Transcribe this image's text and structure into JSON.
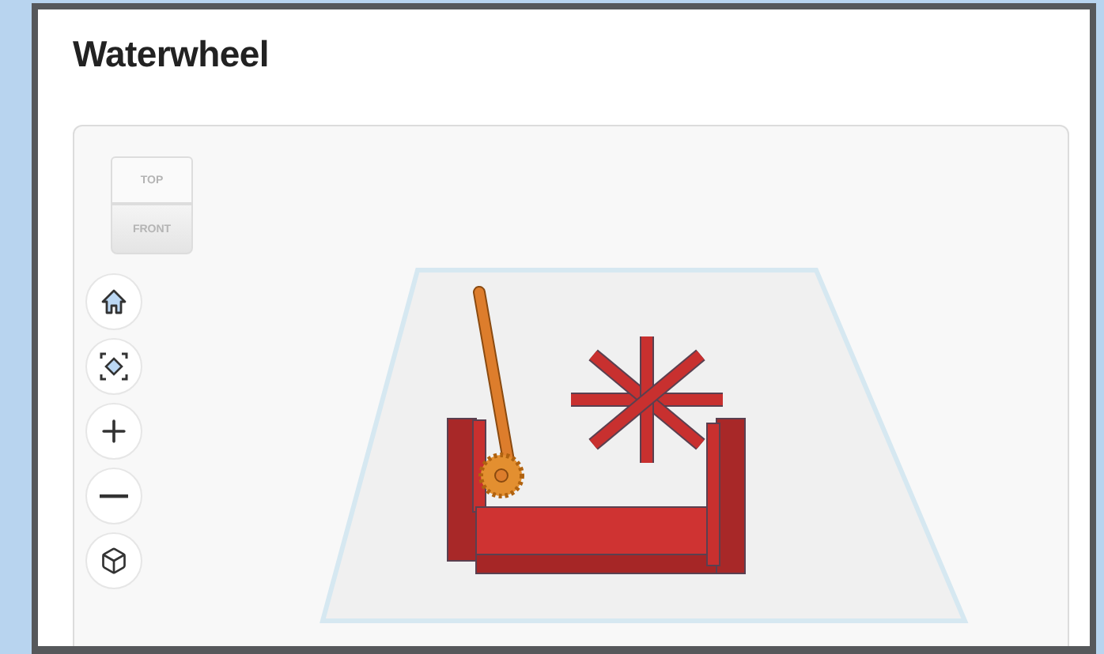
{
  "title": "Waterwheel",
  "viewer": {
    "view_cube": {
      "top": "TOP",
      "front": "FRONT"
    },
    "controls": [
      {
        "kind": "home"
      },
      {
        "kind": "fit"
      },
      {
        "kind": "zoom-in"
      },
      {
        "kind": "zoom-out"
      },
      {
        "kind": "projection"
      }
    ]
  }
}
